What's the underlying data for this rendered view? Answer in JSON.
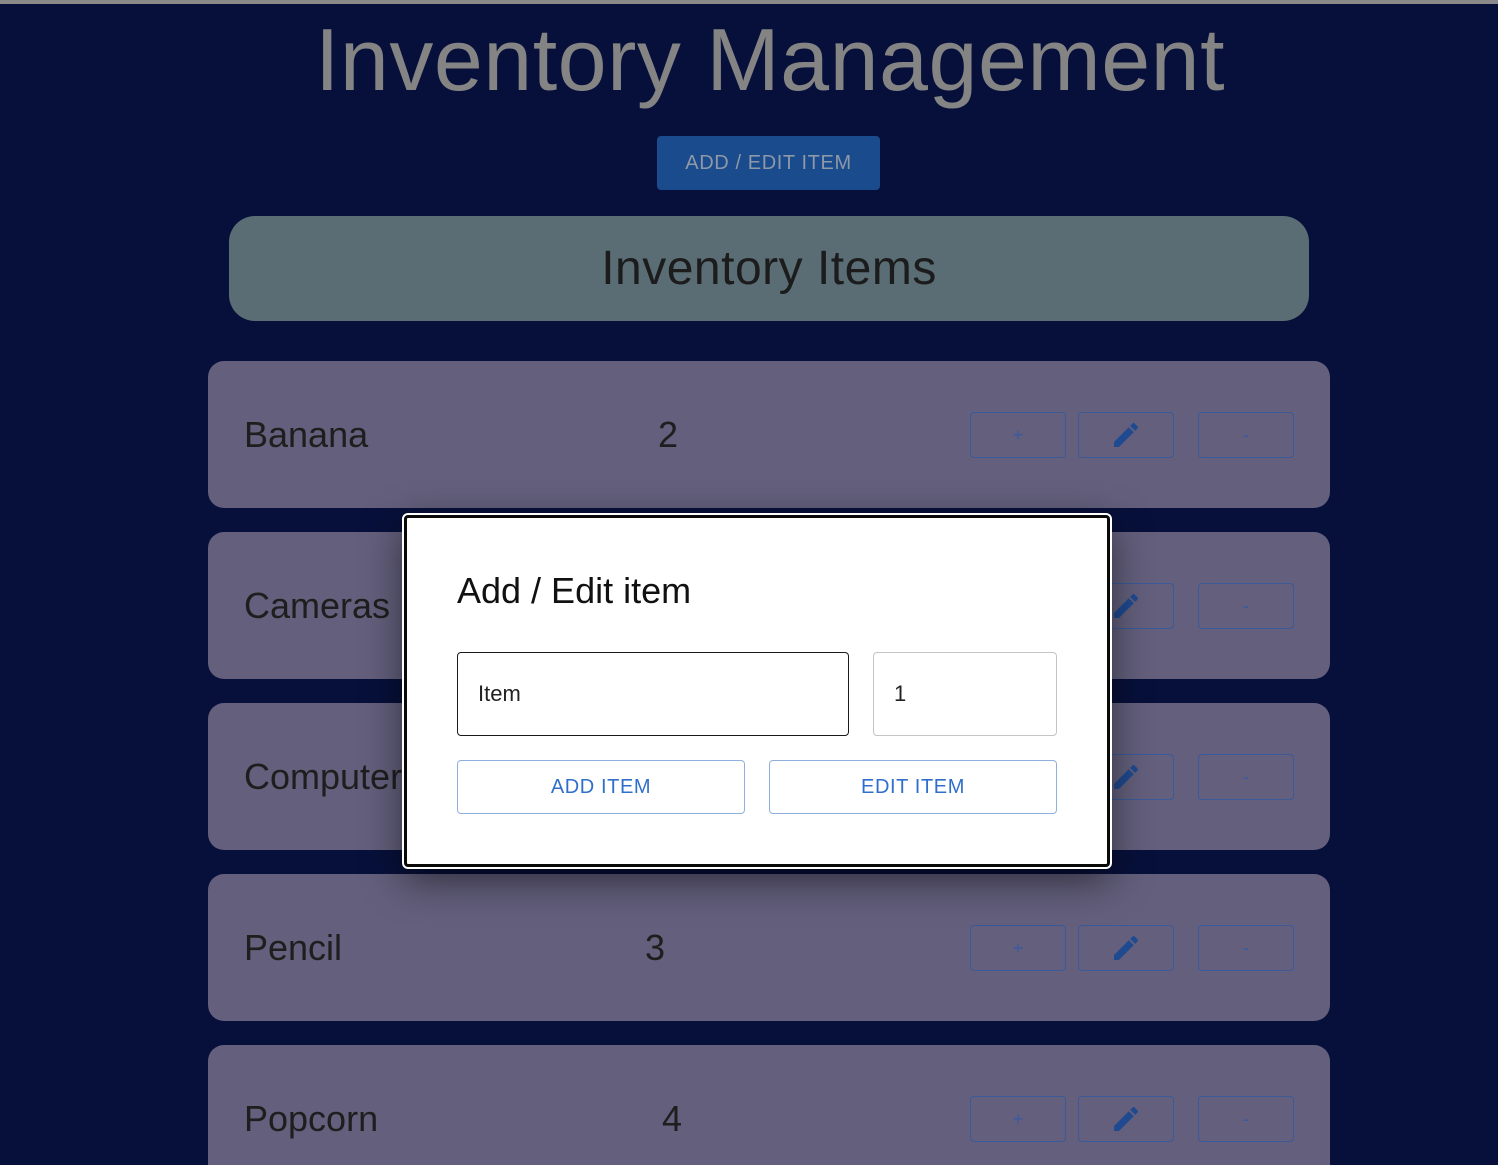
{
  "header": {
    "title": "Inventory Management",
    "open_dialog_button": "ADD / EDIT ITEM"
  },
  "list": {
    "title": "Inventory Items",
    "items": [
      {
        "name": "Banana",
        "quantity": "2"
      },
      {
        "name": "Cameras",
        "quantity": ""
      },
      {
        "name": "Computer",
        "quantity": ""
      },
      {
        "name": "Pencil",
        "quantity": "3"
      },
      {
        "name": "Popcorn",
        "quantity": "4"
      }
    ],
    "row_buttons": {
      "increment_label": "+",
      "decrement_label": "-",
      "edit_icon": "pencil-icon"
    }
  },
  "dialog": {
    "title": "Add / Edit item",
    "name_field": {
      "value": "Item"
    },
    "quantity_field": {
      "value": "1"
    },
    "add_button": "ADD ITEM",
    "edit_button": "EDIT ITEM"
  },
  "colors": {
    "background": "#07103a",
    "header_bar": "#5a6d75",
    "row_card": "#635f7c",
    "primary_button": "#1a4b8c",
    "dialog_accent": "#2f6fcb"
  }
}
